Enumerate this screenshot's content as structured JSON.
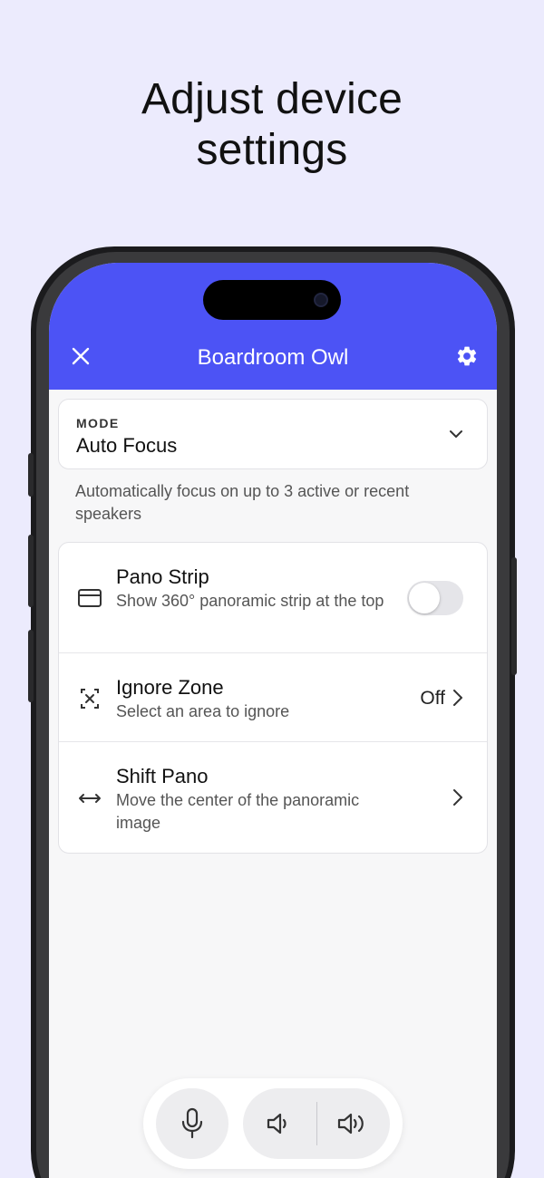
{
  "headline": {
    "line1": "Adjust device",
    "line2": "settings"
  },
  "topbar": {
    "title": "Boardroom Owl",
    "close_icon": "close-icon",
    "settings_icon": "gear-icon",
    "color": "#4C53F5"
  },
  "mode": {
    "label": "MODE",
    "value": "Auto Focus",
    "description": "Automatically focus on up to 3 active or recent speakers"
  },
  "settings": [
    {
      "title": "Pano Strip",
      "subtitle": "Show 360° panoramic strip at the top",
      "control": "toggle",
      "enabled": false,
      "icon": "panel-icon"
    },
    {
      "title": "Ignore Zone",
      "subtitle": "Select an area to ignore",
      "value": "Off",
      "icon": "ignore-zone-icon"
    },
    {
      "title": "Shift Pano",
      "subtitle": "Move the center of the panoramic image",
      "icon": "horizontal-arrows-icon"
    }
  ],
  "controls": {
    "mic_icon": "microphone-icon",
    "volume_down_icon": "volume-down-icon",
    "volume_up_icon": "volume-up-icon"
  },
  "colors": {
    "background": "#ECEBFD",
    "accent": "#4C53F5"
  }
}
